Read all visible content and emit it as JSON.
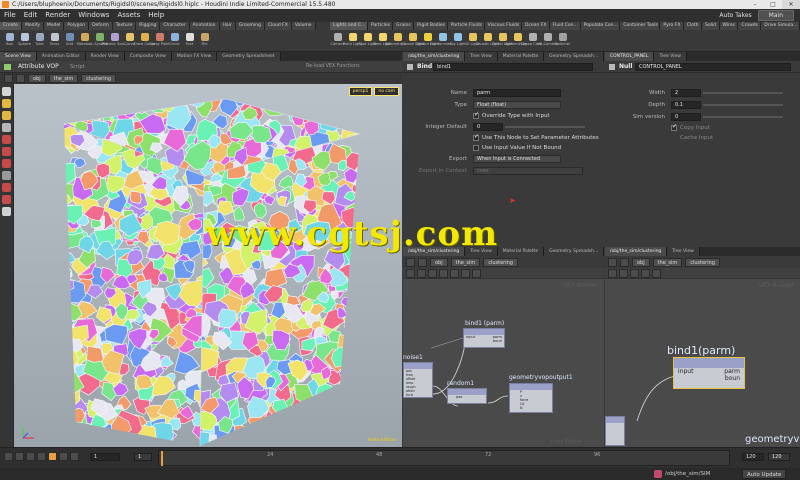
{
  "window": {
    "title": "C:/Users/bluphoenix/Documents/Rigidsl0/scenes/Rigidsl0.hiplc - Houdini Indie Limited-Commercial 15.5.480",
    "controls": [
      "–",
      "□",
      "✕"
    ]
  },
  "menubar": {
    "items": [
      "File",
      "Edit",
      "Render",
      "Windows",
      "Assets",
      "Help"
    ],
    "auto_takes": "Auto Takes",
    "desktop": "Main"
  },
  "shelf": {
    "tabs_left": [
      "Create",
      "Modify",
      "Model",
      "Polygon",
      "Deform",
      "Texture",
      "Rigging",
      "Character",
      "Animation",
      "Hair",
      "Grooming",
      "Cloud FX",
      "Volume"
    ],
    "tabs_right": [
      "Lights and C...",
      "Particles",
      "Grains",
      "Rigid Bodies",
      "Particle Fluids",
      "Viscous Fluids",
      "Ocean FX",
      "Fluid Con...",
      "Populate Con...",
      "Container Tools",
      "Pyro FX",
      "Cloth",
      "Solid",
      "Wires",
      "Crowds",
      "Drive Simula..."
    ],
    "tools_left": [
      {
        "label": "Box",
        "color": "#9fb4d6"
      },
      {
        "label": "Sphere",
        "color": "#b7c6e0"
      },
      {
        "label": "Tube",
        "color": "#9aa9c0"
      },
      {
        "label": "Torus",
        "color": "#c0c7d3"
      },
      {
        "label": "Grid",
        "color": "#6f8fb7"
      },
      {
        "label": "Metaball",
        "color": "#d2a85a"
      },
      {
        "label": "L-System",
        "color": "#7fb36a"
      },
      {
        "label": "Platonic Soli...",
        "color": "#b4a0d0"
      },
      {
        "label": "Curve",
        "color": "#e5c36a"
      },
      {
        "label": "Draw Curve",
        "color": "#e0b14a"
      },
      {
        "label": "Spray Paint",
        "color": "#cf7a6a"
      },
      {
        "label": "Circle",
        "color": "#8ab1d9"
      },
      {
        "label": "Font",
        "color": "#dddddd"
      },
      {
        "label": "File",
        "color": "#c9a36a"
      }
    ],
    "tools_right": [
      {
        "label": "Camera",
        "color": "#b0b0b0"
      },
      {
        "label": "Point Light",
        "color": "#f2d66b"
      },
      {
        "label": "Spot Light",
        "color": "#f2d66b"
      },
      {
        "label": "Area Light",
        "color": "#f2d66b"
      },
      {
        "label": "Geometry L...",
        "color": "#e6c65a"
      },
      {
        "label": "Volume Light",
        "color": "#e6c65a"
      },
      {
        "label": "Distant Light",
        "color": "#f0d040"
      },
      {
        "label": "Environmen...",
        "color": "#8fc3e8"
      },
      {
        "label": "Sky Light",
        "color": "#8fc3e8"
      },
      {
        "label": "GI Light",
        "color": "#e9c65d"
      },
      {
        "label": "Caustic Light",
        "color": "#e9c65d"
      },
      {
        "label": "Portal Light",
        "color": "#e9c65d"
      },
      {
        "label": "Ambient Lig...",
        "color": "#e9c65d"
      },
      {
        "label": "Stereo Cam...",
        "color": "#b0b0b0"
      },
      {
        "label": "VR Camera",
        "color": "#b0b0b0"
      },
      {
        "label": "Switcher",
        "color": "#a0a0a0"
      }
    ]
  },
  "viewport": {
    "tabs": [
      "Scene View",
      "Animation Editor",
      "Render View",
      "Composite View",
      "Motion FX View",
      "Geometry Spreadsheet"
    ],
    "header_title": "Attribute VOP",
    "header_sub": "Script",
    "header_right": "Re-load VEX Functions",
    "path": [
      "obj",
      "the_sim",
      "clustering"
    ],
    "cams": [
      "persp1",
      "no cam"
    ],
    "indie": "Indie Edition"
  },
  "params_bind": {
    "tabs": [
      "/obj/the_sim/clustering",
      "Tree View",
      "Material Palette",
      "Geometry Spreadsh..."
    ],
    "node_type": "Bind",
    "node_name": "bind1",
    "name_label": "Name",
    "name_value": "parm",
    "type_label": "Type",
    "type_value": "Float (float)",
    "override_label": "Override Type with Input",
    "integer_default_label": "Integer Default",
    "integer_default_value": "0",
    "use_node_label": "Use This Node to Set Parameter Attributes",
    "use_input_label": "Use Input Value If Not Bound",
    "export_label": "Export",
    "export_value": "When Input is Connected",
    "export_context_label": "Export in Context",
    "export_context_value": "cvex"
  },
  "params_null": {
    "tabs": [
      "CONTROL_PANEL",
      "Tree View"
    ],
    "node_type": "Null",
    "node_name": "CONTROL_PANEL",
    "width_label": "Width",
    "width_value": "2",
    "depth_label": "Depth",
    "depth_value": "0.1",
    "sim_label": "Sim version",
    "sim_value": "0",
    "copy_input": "Copy Input",
    "cache_input": "Cache Input"
  },
  "net_left": {
    "tabs": [
      "/obj/the_sim/clustering",
      "Tree View",
      "Material Palette",
      "Geometry Spreadsh..."
    ],
    "path": [
      "obj",
      "the_sim",
      "clustering"
    ],
    "context": "VEX Builder",
    "nodes": {
      "bind": {
        "title": "bind1 (parm)",
        "out": "input",
        "ports": [
          "parm",
          "boun"
        ]
      },
      "noise": {
        "title": "noise1",
        "ports": [
          "pos",
          "freq",
          "offset",
          "amp",
          "rough",
          "atten",
          "turb"
        ]
      },
      "random": {
        "title": "random1",
        "ports": [
          "pos"
        ]
      },
      "output": {
        "title": "geometryvopoutput1",
        "ports": [
          "P",
          "v",
          "force",
          "Cd",
          "N"
        ]
      }
    },
    "footer": "Indie Edition"
  },
  "net_right": {
    "tabs": [
      "/obj/the_sim/clustering",
      "Tree View"
    ],
    "path": [
      "obj",
      "the_sim",
      "clustering"
    ],
    "context": "VEX Builder",
    "bind_title": "bind1(parm)",
    "bind_input": "input",
    "bind_ports": [
      "parm",
      "boun"
    ],
    "output_partial": "geometryv"
  },
  "timeline": {
    "frame": "1",
    "start": "1",
    "ticks": [
      "24",
      "48",
      "72",
      "96"
    ],
    "end": "120",
    "end2": "120"
  },
  "statusbar": {
    "path": "/obj/the_sim/SIM",
    "auto_update": "Auto Update"
  },
  "watermark": "www.cgtsj.com"
}
